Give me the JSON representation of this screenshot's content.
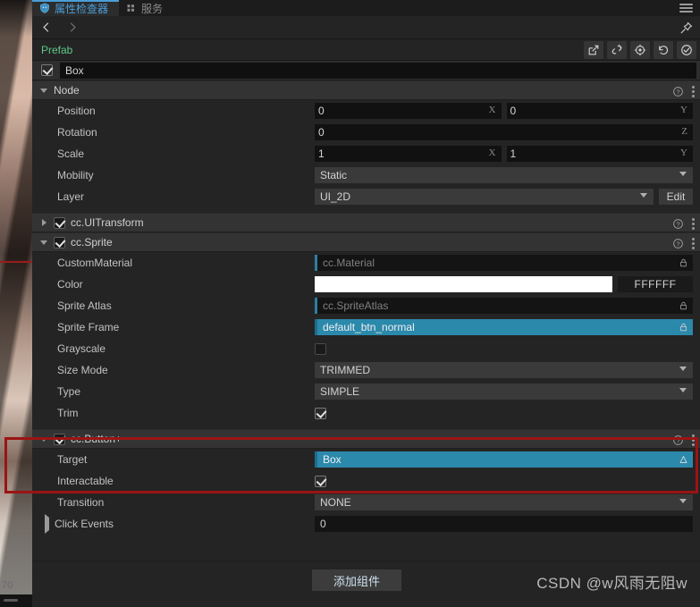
{
  "tabs": [
    {
      "label": "属性检查器",
      "icon": "inspector-icon",
      "active": true
    },
    {
      "label": "服务",
      "icon": "services-icon",
      "active": false
    }
  ],
  "background_image": {
    "page_number": "70"
  },
  "prefab": {
    "label": "Prefab",
    "tools": [
      {
        "name": "edit-prefab-icon",
        "title": "Edit"
      },
      {
        "name": "unlink-prefab-icon",
        "title": "Unlink"
      },
      {
        "name": "locate-prefab-icon",
        "title": "Locate"
      },
      {
        "name": "revert-prefab-icon",
        "title": "Revert"
      },
      {
        "name": "save-prefab-icon",
        "title": "Save"
      }
    ]
  },
  "node_name": {
    "value": "Box",
    "enabled": true
  },
  "sections": {
    "node": {
      "title": "Node",
      "expanded": true,
      "rows": {
        "position": {
          "label": "Position",
          "x": "0",
          "y": "0",
          "axis_x": "X",
          "axis_y": "Y"
        },
        "rotation": {
          "label": "Rotation",
          "z": "0",
          "axis_z": "Z"
        },
        "scale": {
          "label": "Scale",
          "x": "1",
          "y": "1",
          "axis_x": "X",
          "axis_y": "Y"
        },
        "mobility": {
          "label": "Mobility",
          "value": "Static"
        },
        "layer": {
          "label": "Layer",
          "value": "UI_2D",
          "edit_label": "Edit"
        }
      }
    },
    "uitransform": {
      "title": "cc.UITransform",
      "expanded": false,
      "enabled": true
    },
    "sprite": {
      "title": "cc.Sprite",
      "expanded": true,
      "enabled": true,
      "rows": {
        "custom_material": {
          "label": "CustomMaterial",
          "value": "cc.Material",
          "filled": false
        },
        "color": {
          "label": "Color",
          "swatch": "#FFFFFF",
          "hex": "FFFFFF"
        },
        "sprite_atlas": {
          "label": "Sprite Atlas",
          "value": "cc.SpriteAtlas",
          "filled": false
        },
        "sprite_frame": {
          "label": "Sprite Frame",
          "value": "default_btn_normal",
          "filled": true
        },
        "grayscale": {
          "label": "Grayscale",
          "checked": false
        },
        "size_mode": {
          "label": "Size Mode",
          "value": "TRIMMED"
        },
        "type": {
          "label": "Type",
          "value": "SIMPLE"
        },
        "trim": {
          "label": "Trim",
          "checked": true
        }
      }
    },
    "button": {
      "title": "cc.Button+",
      "expanded": true,
      "enabled": true,
      "highlighted": true,
      "rows": {
        "target": {
          "label": "Target",
          "value": "Box",
          "filled": true
        },
        "interactable": {
          "label": "Interactable",
          "checked": true
        },
        "transition": {
          "label": "Transition",
          "value": "NONE"
        },
        "click_events": {
          "label": "Click Events",
          "value": "0",
          "expanded": false
        }
      }
    }
  },
  "footer": {
    "add_component": "添加组件",
    "watermark": "CSDN @w风雨无阻w"
  },
  "colors": {
    "accent": "#4a9ed8",
    "prefab_green": "#5ec98a",
    "asset_filled": "#2b89ab",
    "highlight_border": "#9b1414",
    "panel_bg": "#242424",
    "section_bg": "#333333"
  }
}
